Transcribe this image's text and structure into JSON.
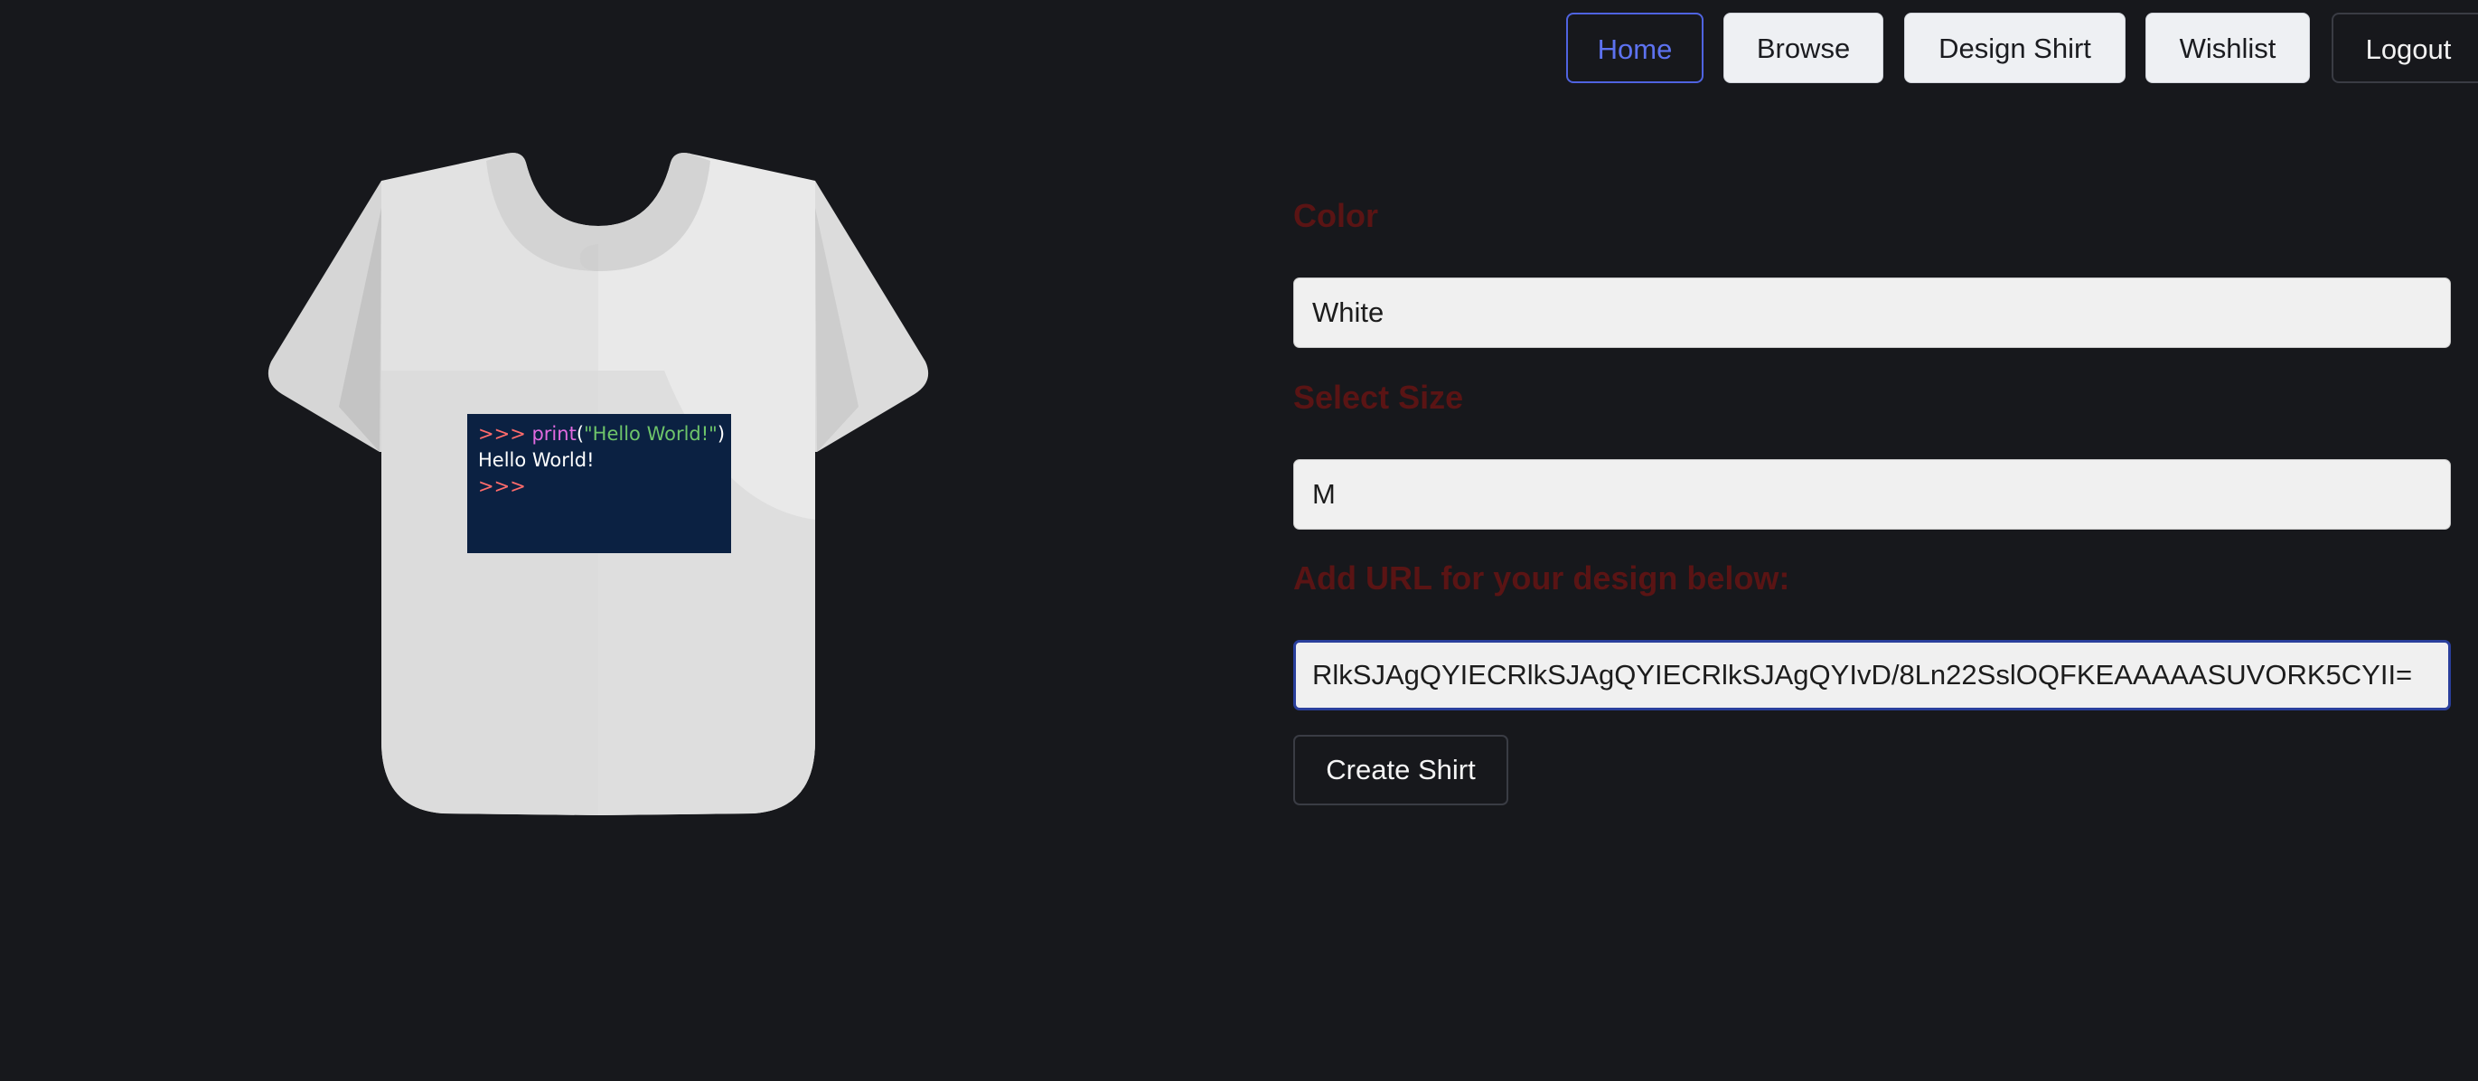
{
  "nav": {
    "home": "Home",
    "browse": "Browse",
    "design_shirt": "Design Shirt",
    "wishlist": "Wishlist",
    "logout": "Logout"
  },
  "shirt": {
    "color": "White",
    "design": {
      "line1_prompt": ">>> ",
      "line1_func": "print",
      "line1_open": "(",
      "line1_str": "\"Hello World!\"",
      "line1_close": ")",
      "line2": "Hello World!",
      "line3_prompt": ">>>"
    }
  },
  "form": {
    "color_label": "Color",
    "color_value": "White",
    "size_label": "Select Size",
    "size_value": "M",
    "url_label": "Add URL for your design below:",
    "url_value": "RlkSJAgQYIECRlkSJAgQYIECRlkSJAgQYIvD/8Ln22SslOQFKEAAAAASUVORK5CYII=",
    "create_button": "Create Shirt"
  },
  "colors": {
    "background": "#17181c",
    "accent": "#5d72f0",
    "label": "#5a1414",
    "design_bg": "#0b2142"
  }
}
